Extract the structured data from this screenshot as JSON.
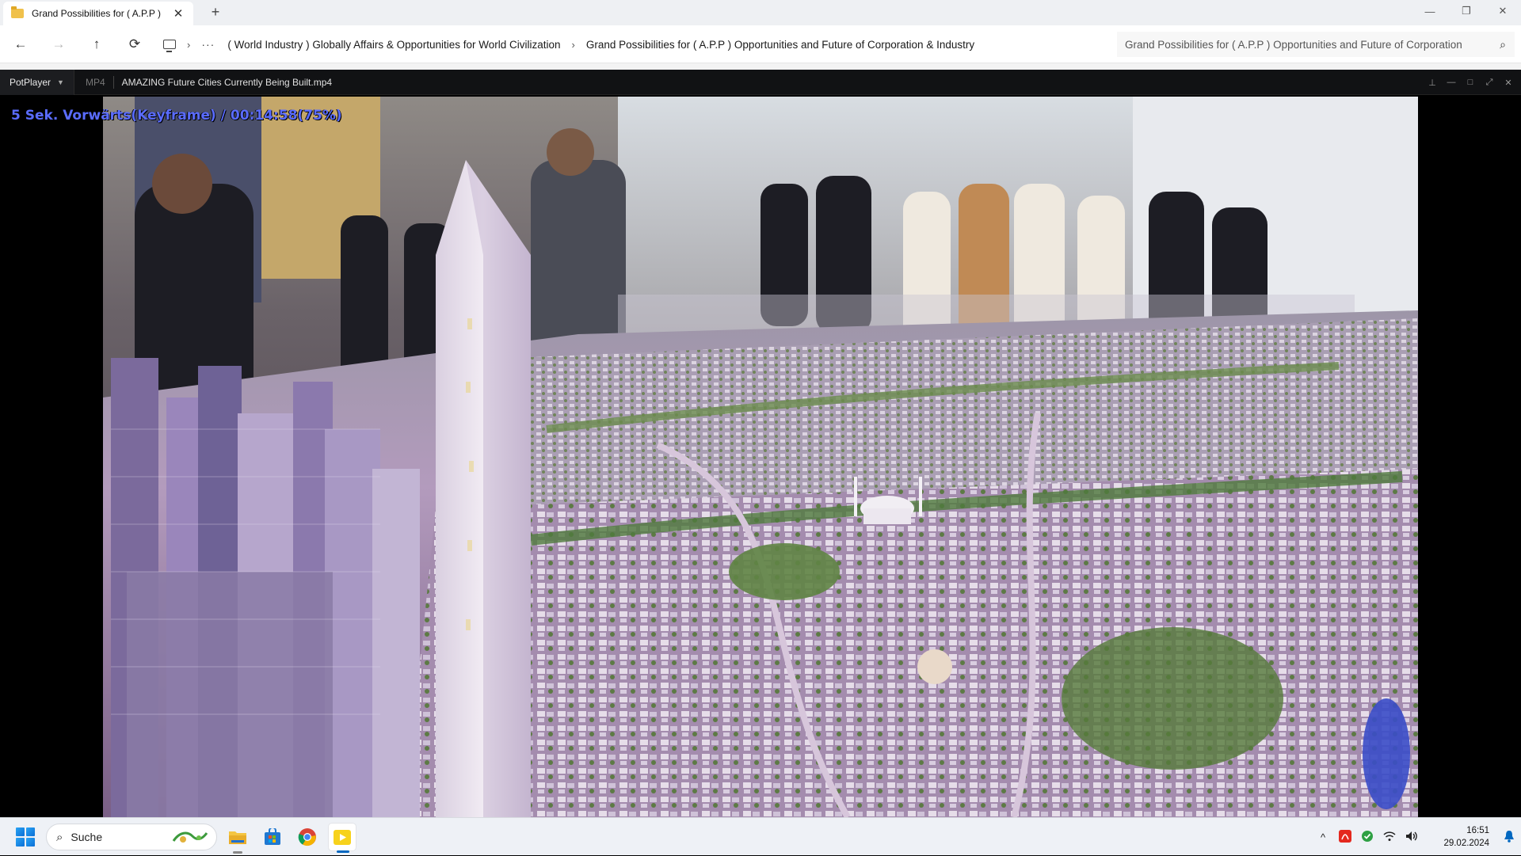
{
  "explorer": {
    "tab_title": "Grand Possibilities for ( A.P.P )",
    "tab_close": "✕",
    "new_tab": "+",
    "window_controls": {
      "minimize": "—",
      "maximize": "❐",
      "close": "✕"
    },
    "nav": {
      "back": "←",
      "forward": "→",
      "up": "↑",
      "refresh": "⟳"
    },
    "breadcrumb": {
      "more": "···",
      "separator": "›",
      "items": [
        "( World Industry ) Globally Affairs & Opportunities for World Civilization",
        "Grand Possibilities for ( A.P.P ) Opportunities and Future of Corporation & Industry"
      ]
    },
    "search_text": "Grand Possibilities for ( A.P.P ) Opportunities and Future of Corporation",
    "search_icon": "⌕"
  },
  "player": {
    "app_name": "PotPlayer",
    "format": "MP4",
    "file_name": "AMAZING Future Cities Currently Being Built.mp4",
    "osd_text": "5 Sek. Vorwärts(Keyframe) / 00:14:58(75%)",
    "controls": {
      "pin": "⊥",
      "minimize": "—",
      "maximize": "□",
      "fullscreen": "⤢",
      "close": "✕"
    }
  },
  "taskbar": {
    "search_placeholder": "Suche",
    "apps": [
      "file-explorer",
      "microsoft-store",
      "chrome",
      "potplayer"
    ],
    "tray": {
      "overflow": "^",
      "time": "16:51",
      "date": "29.02.2024"
    }
  },
  "colors": {
    "accent": "#0067c0",
    "osd": "#5a6cff",
    "player_bar": "#111214"
  }
}
